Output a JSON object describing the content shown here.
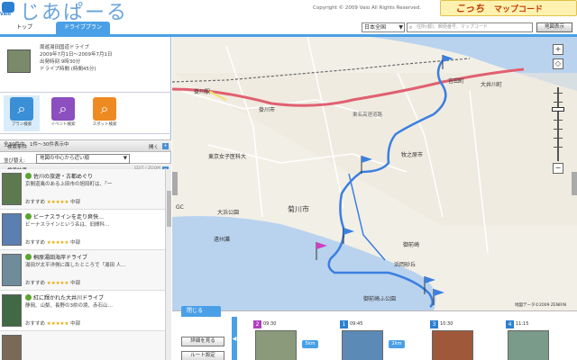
{
  "header": {
    "logo_sub": "Vaio",
    "logo_text": "じあぱーる",
    "copyright": "Copyright © 2009 Vaio All Rights Reserved.",
    "brand_small": "こっち",
    "brand_big": "マップコード",
    "tabs": [
      {
        "label": "トップ"
      },
      {
        "label": "ドライブプラン"
      }
    ],
    "region": "日本全国",
    "search_placeholder": "住所(都)、郵便番号、マップコード",
    "search_button": "地図表示"
  },
  "route": {
    "lines": [
      "周遊湯田国道ドライブ",
      "2009年7月1日〜2009年7月1日",
      "出発時刻 9時30分",
      "ドライブ時間 (時間45分)"
    ]
  },
  "modes": [
    {
      "label": "プラン検索",
      "icon": "car-search-icon"
    },
    {
      "label": "イベント検索",
      "icon": "event-search-icon"
    },
    {
      "label": "スポット検索",
      "icon": "spot-search-icon"
    }
  ],
  "sections": {
    "conditions": {
      "title": "検索条件",
      "right": "開く"
    },
    "results": {
      "title": "検索結果",
      "pager": "EDIT / ZOOM"
    }
  },
  "results": {
    "count": "全30件中、1件〜30件表示中",
    "sort_label": "並び替え:",
    "sort_value": "地図の中心から近い順"
  },
  "items": [
    {
      "name": "佐川の旅遊・古都めぐり",
      "desc": "京間道風のある上田市の旭田町は、「一",
      "rate_label": "おすすめ",
      "stars": "★★★★★",
      "area": "中部",
      "thumb": "#5d7a4f"
    },
    {
      "name": "ビーナスラインを走り爽快…",
      "desc": "ビーナスラインという名は、旧間科…",
      "rate_label": "おすすめ",
      "stars": "★★★★★",
      "area": "中部",
      "thumb": "#5a7fb0"
    },
    {
      "name": "桐原湯田海岸ドライブ",
      "desc": "湯田が太平洋側に面したところで「湯田 人…",
      "rate_label": "おすすめ",
      "stars": "★★★★★",
      "area": "中部",
      "thumb": "#6e8c9a"
    },
    {
      "name": "紅に輝かれた大井川ドライブ",
      "desc": "静岡、山梨、長野の3県の境、赤石山…",
      "rate_label": "おすすめ",
      "stars": "★★★★★",
      "area": "中部",
      "thumb": "#3f6a44"
    },
    {
      "name": "",
      "desc": "",
      "rate_label": "",
      "stars": "",
      "area": "",
      "thumb": "#7a6a55"
    }
  ],
  "map": {
    "labels": [
      {
        "text": "掛川駅",
        "cls": ""
      },
      {
        "text": "掛川市",
        "cls": ""
      },
      {
        "text": "東名高速道路",
        "cls": "road"
      },
      {
        "text": "吉田町",
        "cls": ""
      },
      {
        "text": "大井川町",
        "cls": ""
      },
      {
        "text": "牧之原市",
        "cls": ""
      },
      {
        "text": "東京女子医科大",
        "cls": ""
      },
      {
        "text": "菊川市",
        "cls": "big"
      },
      {
        "text": "大浜公園",
        "cls": ""
      },
      {
        "text": "御前崎",
        "cls": ""
      },
      {
        "text": "浜岡砂丘",
        "cls": ""
      },
      {
        "text": "遠州灘",
        "cls": ""
      },
      {
        "text": "GC",
        "cls": ""
      },
      {
        "text": "御前崎ふ公園",
        "cls": ""
      }
    ],
    "copyright": "地図データ©2009 ZENRIN",
    "zoom_in": "+",
    "zoom_out": "−"
  },
  "strip": {
    "tab": "閉じる",
    "btn_detail": "詳細を見る",
    "btn_route": "ルート設定",
    "spots": [
      {
        "num": "2",
        "time": "09:30",
        "conn": "5km",
        "num_color": "#b040c0",
        "photo": "#8a9a7a"
      },
      {
        "num": "1",
        "time": "09:45",
        "conn": "2km",
        "num_color": "#2d7fd1",
        "photo": "#5a8ab5"
      },
      {
        "num": "3",
        "time": "10:30",
        "conn": "",
        "num_color": "#2d7fd1",
        "photo": "#a0583a"
      },
      {
        "num": "4",
        "time": "11:15",
        "conn": "",
        "num_color": "#2d7fd1",
        "photo": "#7a9a8a"
      }
    ]
  },
  "colors": {
    "accent": "#4aa0e6",
    "route_line": "#3b7fe0",
    "highway": "#e06070"
  }
}
